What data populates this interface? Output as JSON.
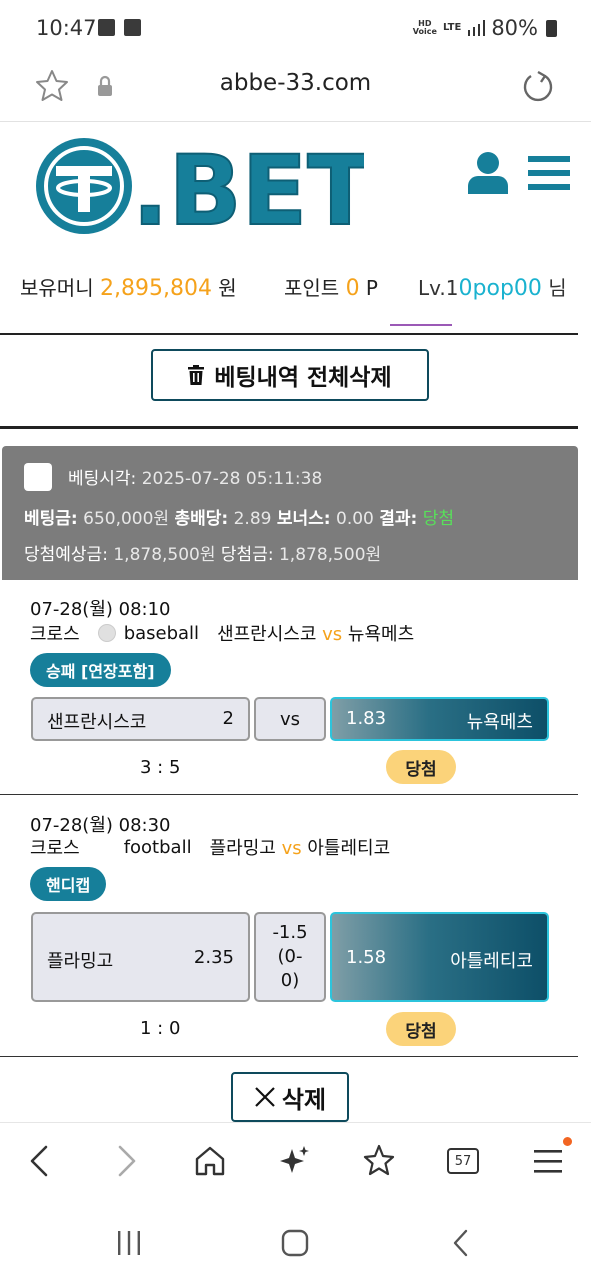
{
  "status_bar": {
    "time": "10:47",
    "hd_label": "HD",
    "voice_label": "Voice",
    "lte_label": "LTE",
    "battery": "80%"
  },
  "browser": {
    "url": "abbe-33.com",
    "tabs_count": "57"
  },
  "header": {
    "logo_text": ".BET",
    "brand_color": "#167f9a"
  },
  "balance": {
    "money_label": "보유머니",
    "money_value": "2,895,804",
    "money_unit": "원",
    "point_label": "포인트",
    "point_value": "0",
    "point_unit": "P",
    "level_prefix": "Lv.1",
    "username": "0pop00",
    "username_suffix": "님"
  },
  "delete_all_label": "베팅내역 전체삭제",
  "bet": {
    "time_label": "베팅시각:",
    "time_value": "2025-07-28 05:11:38",
    "amount_label": "베팅금:",
    "amount_value": "650,000원",
    "total_odds_label": "총배당:",
    "total_odds_value": "2.89",
    "bonus_label": "보너스:",
    "bonus_value": "0.00",
    "result_label": "결과:",
    "result_value": "당첨",
    "expected_label": "당첨예상금:",
    "expected_value": "1,878,500원",
    "win_label": "당첨금:",
    "win_value": "1,878,500원"
  },
  "games": [
    {
      "datetime": "07-28(월) 08:10",
      "category": "크로스",
      "sport": "baseball",
      "home": "샌프란시스코",
      "vs": "vs",
      "away": "뉴욕메츠",
      "market": "승패 [연장포함]",
      "home_odds": "2",
      "middle": "vs",
      "away_odds": "1.83",
      "score": "3 : 5",
      "result": "당첨"
    },
    {
      "datetime": "07-28(월) 08:30",
      "category": "크로스",
      "sport": "football",
      "home": "플라밍고",
      "vs": "vs",
      "away": "아틀레티코",
      "market": "핸디캡",
      "home_odds": "2.35",
      "middle_line1": "-1.5",
      "middle_line2": "(0-",
      "middle_line3": "0)",
      "away_odds": "1.58",
      "score": "1 : 0",
      "result": "당첨"
    }
  ],
  "delete_label": "삭제"
}
